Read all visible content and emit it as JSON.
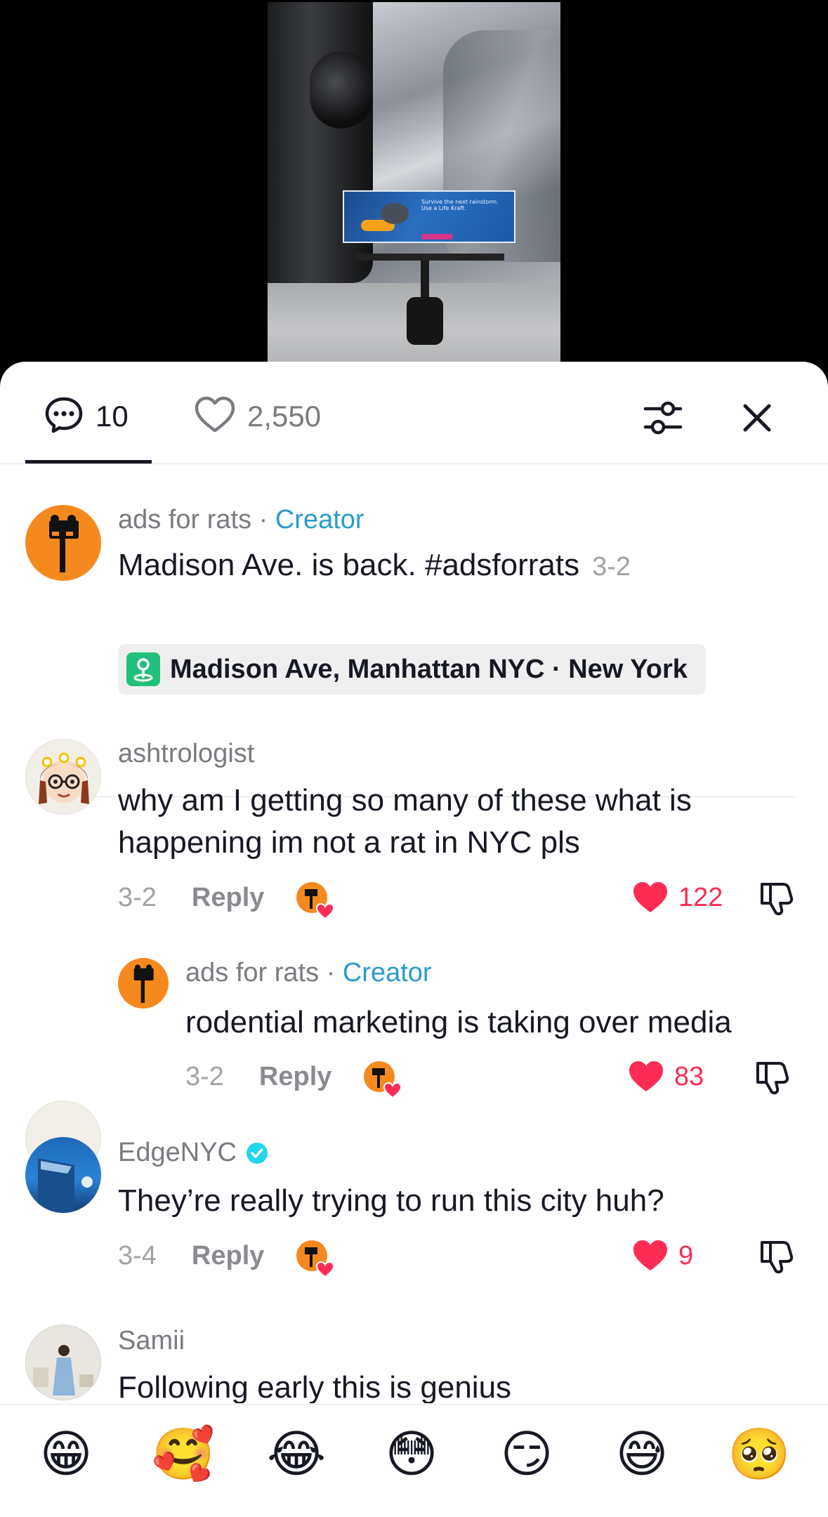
{
  "video": {
    "sign_text": "Survive the next rainstorm. Use a Life Kraft."
  },
  "header": {
    "comment_count": "10",
    "like_count": "2,550",
    "icons": {
      "comments": "chat-bubble-icon",
      "likes": "heart-outline-icon",
      "filter": "filter-sliders-icon",
      "close": "close-icon"
    }
  },
  "caption": {
    "username": "ads for rats",
    "separator": " · ",
    "creator_label": "Creator",
    "text": "Madison Ave. is back. #adsforrats",
    "date": "3-2",
    "location": "Madison Ave, Manhattan NYC · New York"
  },
  "comments": [
    {
      "username": "ashtrologist",
      "text": "why am I getting so many of these what is happening im not a rat in NYC pls",
      "date": "3-2",
      "reply_label": "Reply",
      "likes": "122"
    },
    {
      "username": "ads for rats",
      "separator": " · ",
      "creator_label": "Creator",
      "text": "rodential marketing is taking over media",
      "date": "3-2",
      "reply_label": "Reply",
      "likes": "83"
    },
    {
      "username": "EdgeNYC",
      "text": "They’re really trying to run this city huh?",
      "date": "3-4",
      "reply_label": "Reply",
      "likes": "9"
    },
    {
      "username": "Samii",
      "text": "Following early this is genius"
    }
  ],
  "emoji_bar": [
    "😁",
    "🥰",
    "😂",
    "😳",
    "😏",
    "😅",
    "🥺"
  ],
  "colors": {
    "accent_red": "#fe2c55",
    "creator_blue": "#2b9bcf",
    "rat_orange": "#f5891e",
    "location_green": "#20c07a"
  }
}
